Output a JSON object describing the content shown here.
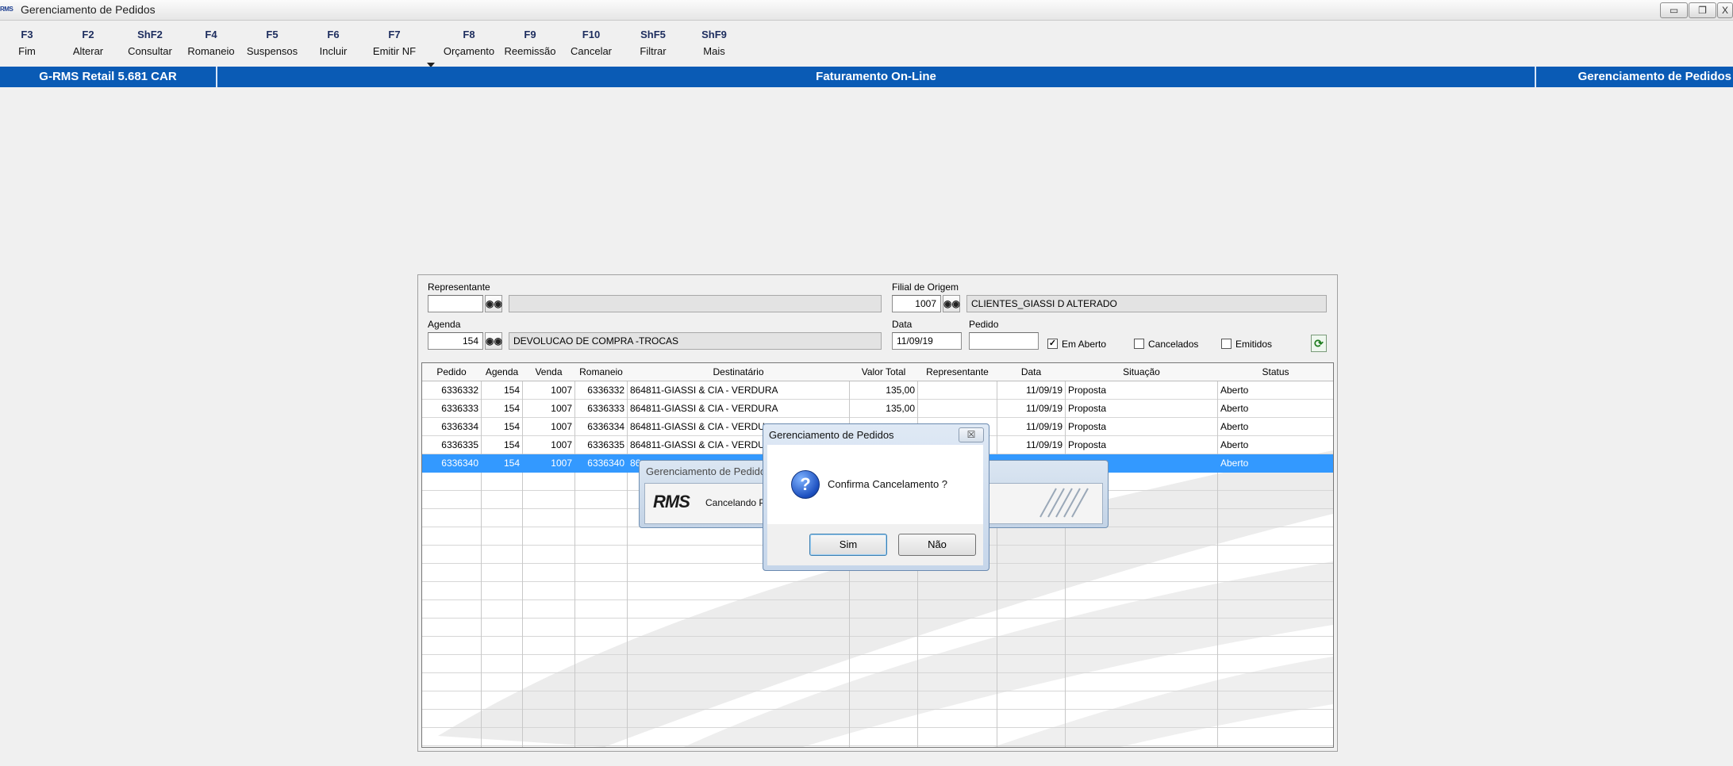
{
  "window": {
    "title": "Gerenciamento de Pedidos",
    "app_icon_text": "RMS",
    "controls": {
      "minimize": "▭",
      "restore": "❐",
      "close": "X"
    }
  },
  "toolbar": [
    {
      "key": "F3",
      "label": "Fim"
    },
    {
      "key": "F2",
      "label": "Alterar"
    },
    {
      "key": "ShF2",
      "label": "Consultar"
    },
    {
      "key": "F4",
      "label": "Romaneio"
    },
    {
      "key": "F5",
      "label": "Suspensos"
    },
    {
      "key": "F6",
      "label": "Incluir"
    },
    {
      "key": "F7",
      "label": "Emitir NF"
    },
    {
      "key": "F8",
      "label": "Orçamento"
    },
    {
      "key": "F9",
      "label": "Reemissão"
    },
    {
      "key": "F10",
      "label": "Cancelar"
    },
    {
      "key": "ShF5",
      "label": "Filtrar"
    },
    {
      "key": "ShF9",
      "label": "Mais"
    }
  ],
  "statusbar": {
    "left": "G-RMS Retail 5.681 CAR",
    "center": "Faturamento On-Line",
    "right": "Gerenciamento de Pedidos"
  },
  "filters": {
    "representante_label": "Representante",
    "representante_code": "",
    "representante_name": "",
    "filial_label": "Filial de Origem",
    "filial_code": "1007",
    "filial_name": "CLIENTES_GIASSI D ALTERADO",
    "agenda_label": "Agenda",
    "agenda_code": "154",
    "agenda_name": "DEVOLUCAO DE COMPRA -TROCAS",
    "data_label": "Data",
    "data_value": "11/09/19",
    "pedido_label": "Pedido",
    "pedido_value": "",
    "em_aberto_label": "Em Aberto",
    "em_aberto_checked": "✓",
    "cancelados_label": "Cancelados",
    "emitidos_label": "Emitidos"
  },
  "table": {
    "columns": [
      "Pedido",
      "Agenda",
      "Venda",
      "Romaneio",
      "Destinatário",
      "Valor Total",
      "Representante",
      "Data",
      "Situação",
      "Status"
    ],
    "rows": [
      {
        "pedido": "6336332",
        "agenda": "154",
        "venda": "1007",
        "romaneio": "6336332",
        "destinatario": "864811-GIASSI & CIA - VERDURA",
        "valor": "135,00",
        "representante": "",
        "data": "11/09/19",
        "situacao": "Proposta",
        "status": "Aberto"
      },
      {
        "pedido": "6336333",
        "agenda": "154",
        "venda": "1007",
        "romaneio": "6336333",
        "destinatario": "864811-GIASSI & CIA - VERDURA",
        "valor": "135,00",
        "representante": "",
        "data": "11/09/19",
        "situacao": "Proposta",
        "status": "Aberto"
      },
      {
        "pedido": "6336334",
        "agenda": "154",
        "venda": "1007",
        "romaneio": "6336334",
        "destinatario": "864811-GIASSI & CIA - VERDU",
        "valor": "",
        "representante": "",
        "data": "11/09/19",
        "situacao": "Proposta",
        "status": "Aberto"
      },
      {
        "pedido": "6336335",
        "agenda": "154",
        "venda": "1007",
        "romaneio": "6336335",
        "destinatario": "864811-GIASSI & CIA - VERDU",
        "valor": "",
        "representante": "",
        "data": "11/09/19",
        "situacao": "Proposta",
        "status": "Aberto"
      },
      {
        "pedido": "6336340",
        "agenda": "154",
        "venda": "1007",
        "romaneio": "6336340",
        "destinatario": "86",
        "valor": "",
        "representante": "",
        "data": "",
        "situacao": "",
        "status": "Aberto",
        "selected": true
      }
    ]
  },
  "progress_dialog": {
    "title": "Gerenciamento de Pedido",
    "logo": "RMS",
    "message": "Cancelando Pe"
  },
  "confirm_dialog": {
    "title": "Gerenciamento de Pedidos",
    "close": "☒",
    "icon": "?",
    "message": "Confirma Cancelamento ?",
    "yes": "Sim",
    "no": "Não"
  },
  "colors": {
    "band": "#0a5bb5",
    "selection": "#3399ff",
    "dialog_frame": "#c6d6ea"
  }
}
